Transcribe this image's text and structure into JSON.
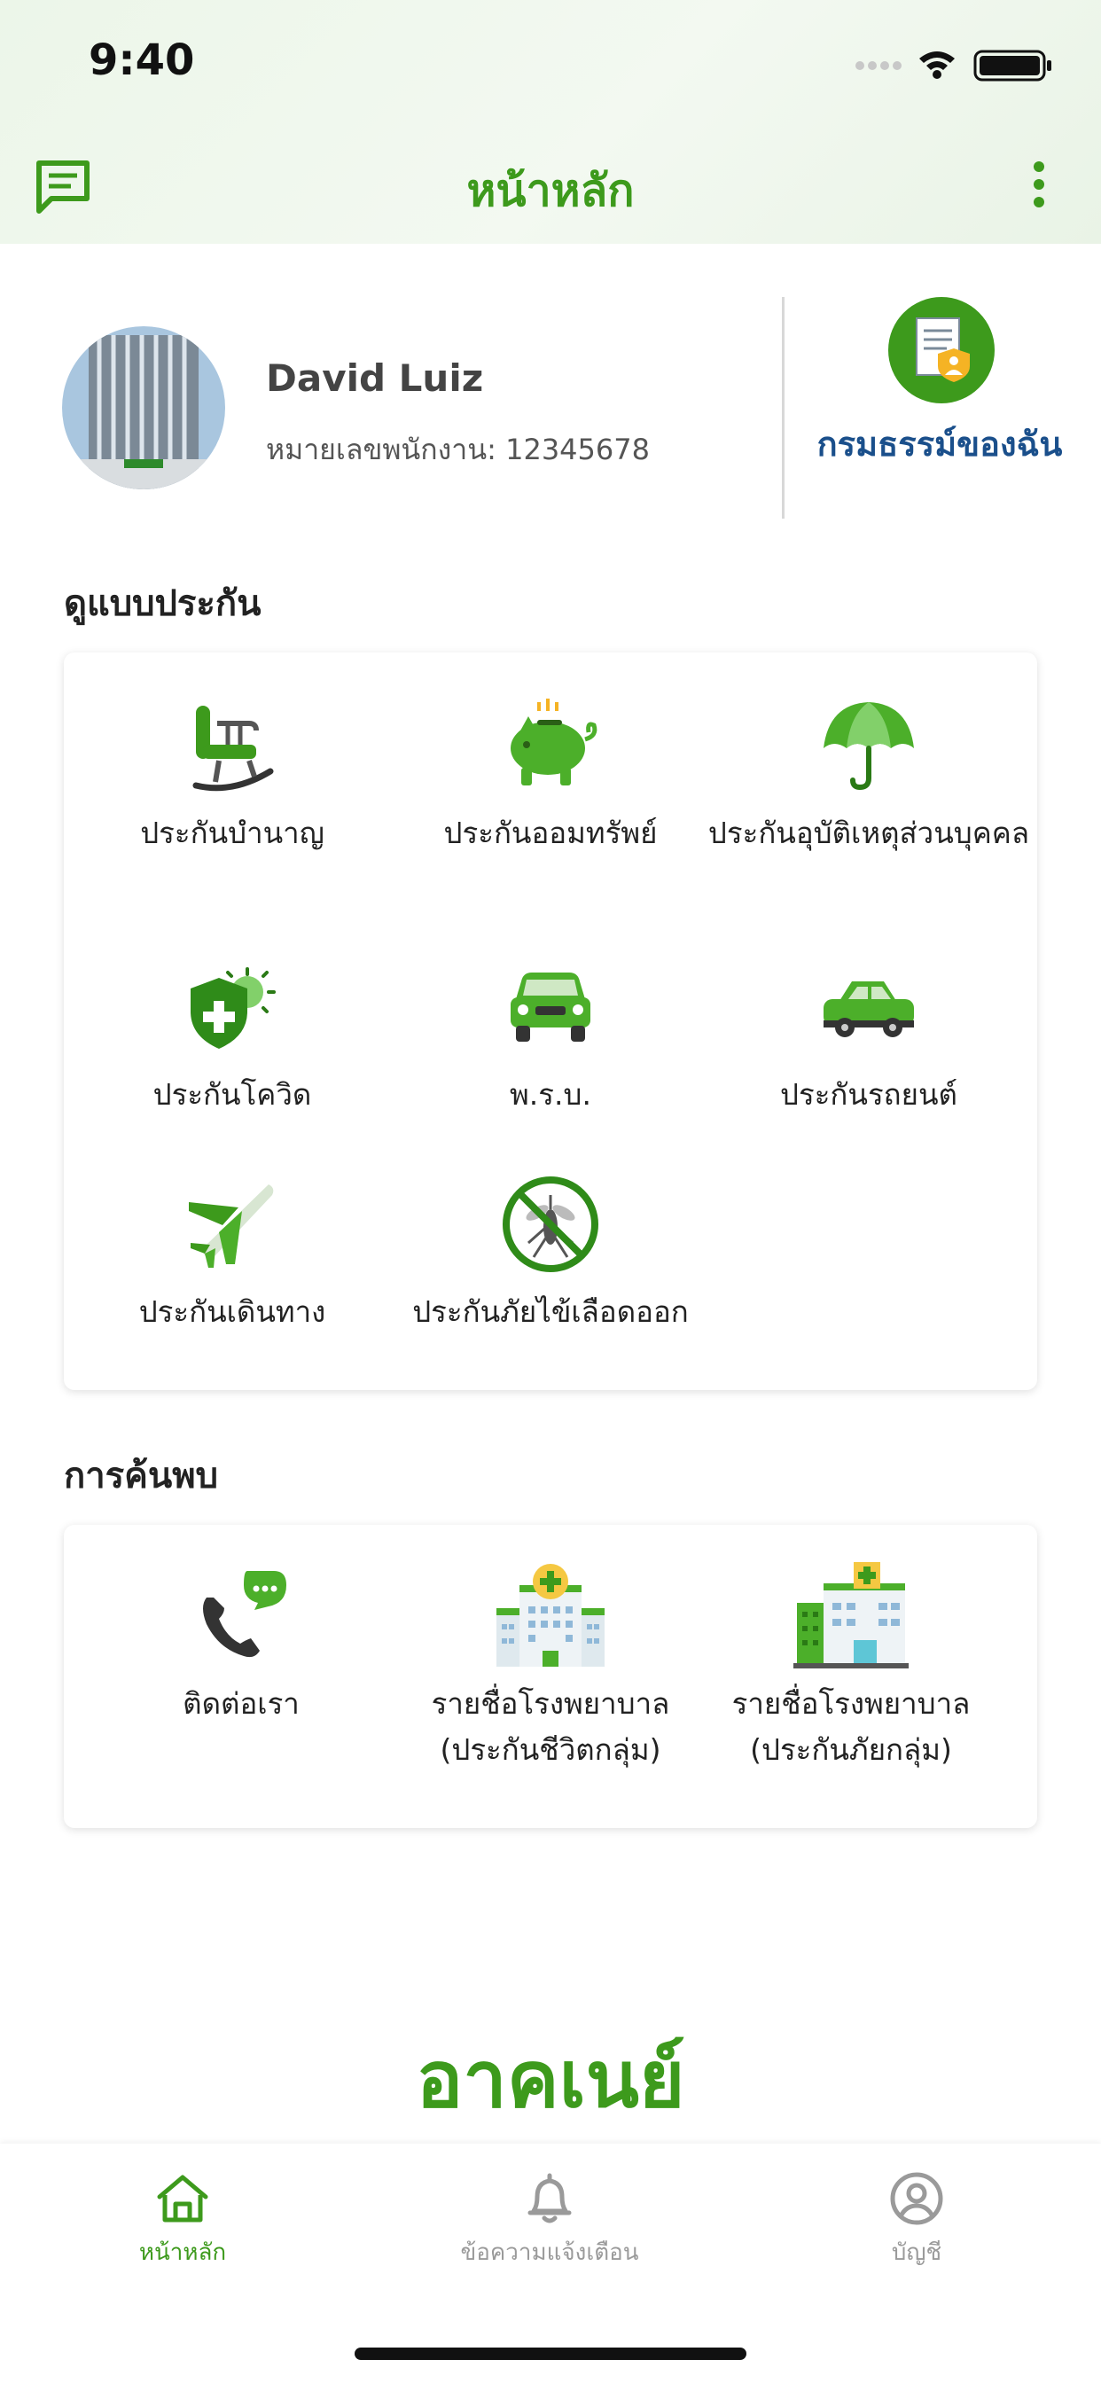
{
  "status_bar": {
    "time": "9:40"
  },
  "header": {
    "title": "หน้าหลัก"
  },
  "profile": {
    "name": "David Luiz",
    "employee_id": "หมายเลขพนักงาน: 12345678",
    "my_policy_label": "กรมธรรม์ของฉัน"
  },
  "insurance": {
    "section_title": "ดูแบบประกัน",
    "items": [
      {
        "label": "ประกันบำนาญ",
        "icon": "rocking-chair-icon"
      },
      {
        "label": "ประกันออมทรัพย์",
        "icon": "piggy-bank-icon"
      },
      {
        "label": "ประกันอุบัติเหตุส่วนบุคคล",
        "icon": "umbrella-icon"
      },
      {
        "label": "ประกันโควิด",
        "icon": "virus-shield-icon"
      },
      {
        "label": "พ.ร.บ.",
        "icon": "car-front-icon"
      },
      {
        "label": "ประกันรถยนต์",
        "icon": "car-side-icon"
      },
      {
        "label": "ประกันเดินทาง",
        "icon": "airplane-icon"
      },
      {
        "label": "ประกันภัยไข้เลือดออก",
        "icon": "no-mosquito-icon"
      }
    ]
  },
  "discover": {
    "section_title": "การค้นพบ",
    "items": [
      {
        "label": "ติดต่อเรา",
        "icon": "phone-chat-icon"
      },
      {
        "label": "รายชื่อโรงพยาบาล (ประกันชีวิตกลุ่ม)",
        "icon": "hospital-icon"
      },
      {
        "label": "รายชื่อโรงพยาบาล (ประกันภัยกลุ่ม)",
        "icon": "hospital-building-icon"
      }
    ]
  },
  "brand": "อาคเนย์",
  "bottom_nav": {
    "items": [
      {
        "label": "หน้าหลัก",
        "icon": "home-icon",
        "active": true
      },
      {
        "label": "ข้อความแจ้งเตือน",
        "icon": "bell-icon",
        "active": false
      },
      {
        "label": "บัญชี",
        "icon": "account-icon",
        "active": false
      }
    ]
  },
  "colors": {
    "accent": "#3d9a1c",
    "link": "#1a4f8b",
    "inactive": "#9a9a9a"
  }
}
